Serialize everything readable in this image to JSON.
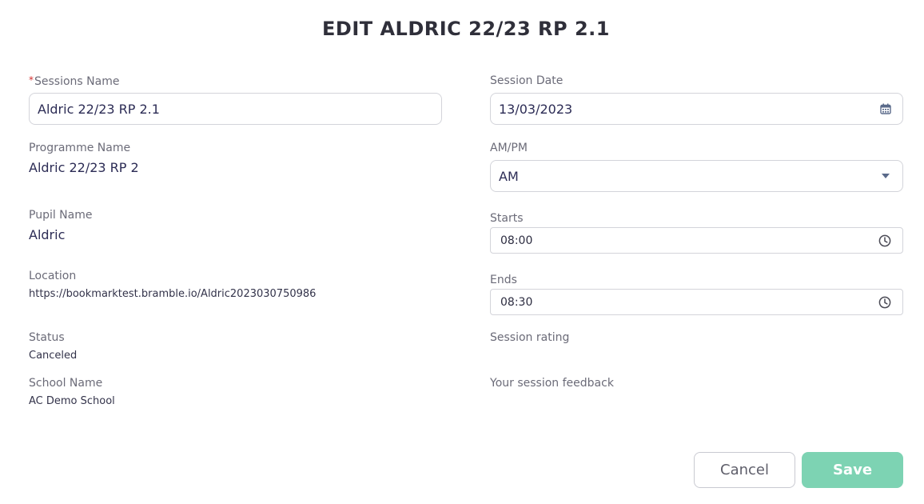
{
  "dialog": {
    "title": "EDIT ALDRIC 22/23 RP 2.1"
  },
  "left": {
    "sessions_name": {
      "required_mark": "*",
      "label": "Sessions Name",
      "value": "Aldric 22/23 RP 2.1"
    },
    "programme_name": {
      "label": "Programme Name",
      "value": "Aldric 22/23 RP 2"
    },
    "pupil_name": {
      "label": "Pupil Name",
      "value": "Aldric"
    },
    "location": {
      "label": "Location",
      "value": "https://bookmarktest.bramble.io/Aldric2023030750986"
    },
    "status": {
      "label": "Status",
      "value": "Canceled"
    },
    "school_name": {
      "label": "School Name",
      "value": "AC Demo School"
    }
  },
  "right": {
    "session_date": {
      "label": "Session Date",
      "value": "13/03/2023",
      "icon": "calendar-icon"
    },
    "am_pm": {
      "label": "AM/PM",
      "value": "AM",
      "icon": "caret-down-icon"
    },
    "starts": {
      "label": "Starts",
      "value": "08:00",
      "icon": "clock-icon"
    },
    "ends": {
      "label": "Ends",
      "value": "08:30",
      "icon": "clock-icon"
    },
    "session_rating": {
      "label": "Session rating"
    },
    "session_feedback": {
      "label": "Your session feedback"
    }
  },
  "actions": {
    "cancel_label": "Cancel",
    "save_label": "Save"
  },
  "colors": {
    "save_button": "#7dd3b3",
    "required_mark": "#d32f2f",
    "icon": "#5a6a8a"
  }
}
